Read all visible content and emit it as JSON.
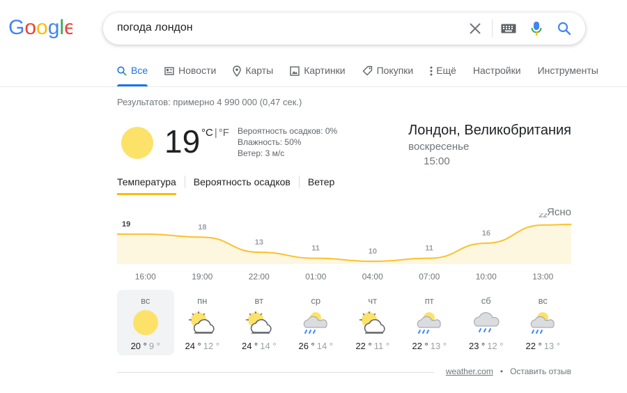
{
  "search": {
    "query": "погода лондон"
  },
  "tabs": [
    {
      "label": "Все",
      "icon": "search-icon"
    },
    {
      "label": "Новости",
      "icon": "news-icon"
    },
    {
      "label": "Карты",
      "icon": "map-pin-icon"
    },
    {
      "label": "Картинки",
      "icon": "image-icon"
    },
    {
      "label": "Покупки",
      "icon": "tag-icon"
    },
    {
      "label": "Ещё",
      "icon": "more-vert-icon"
    }
  ],
  "tools": {
    "settings": "Настройки",
    "tools": "Инструменты"
  },
  "results_count": "Результатов: примерно 4 990 000 (0,47 сек.)",
  "weather": {
    "temp": "19",
    "unit_c": "°C",
    "unit_sep": "|",
    "unit_f": "°F",
    "precip": "Вероятность осадков: 0%",
    "humidity": "Влажность: 50%",
    "wind": "Ветер: 3 м/с",
    "location": "Лондон, Великобритания",
    "daytime": "воскресенье 15:00",
    "condition": "Ясно",
    "tabs": [
      "Температура",
      "Вероятность осадков",
      "Ветер"
    ],
    "colors": {
      "line": "#fbc02d",
      "fill": "#fef7e0",
      "sun": "#fde26a"
    }
  },
  "chart_data": {
    "type": "area",
    "x": [
      "16:00",
      "19:00",
      "22:00",
      "01:00",
      "04:00",
      "07:00",
      "10:00",
      "13:00"
    ],
    "values": [
      19,
      18,
      13,
      11,
      10,
      11,
      16,
      22
    ],
    "labels": [
      "19",
      "18",
      "13",
      "11",
      "10",
      "11",
      "16",
      "22"
    ]
  },
  "days": [
    {
      "name": "вс",
      "hi": "20 °",
      "lo": "9 °",
      "icon": "sunny"
    },
    {
      "name": "пн",
      "hi": "24 °",
      "lo": "12 °",
      "icon": "partly-cloudy"
    },
    {
      "name": "вт",
      "hi": "24 °",
      "lo": "14 °",
      "icon": "partly-cloudy"
    },
    {
      "name": "ср",
      "hi": "26 °",
      "lo": "14 °",
      "icon": "rain-sun"
    },
    {
      "name": "чт",
      "hi": "22 °",
      "lo": "11 °",
      "icon": "partly-cloudy"
    },
    {
      "name": "пт",
      "hi": "22 °",
      "lo": "13 °",
      "icon": "rain-sun"
    },
    {
      "name": "сб",
      "hi": "23 °",
      "lo": "12 °",
      "icon": "rain"
    },
    {
      "name": "вс",
      "hi": "22 °",
      "lo": "13 °",
      "icon": "rain-sun"
    }
  ],
  "footer": {
    "source": "weather.com",
    "dot": "•",
    "feedback": "Оставить отзыв"
  }
}
